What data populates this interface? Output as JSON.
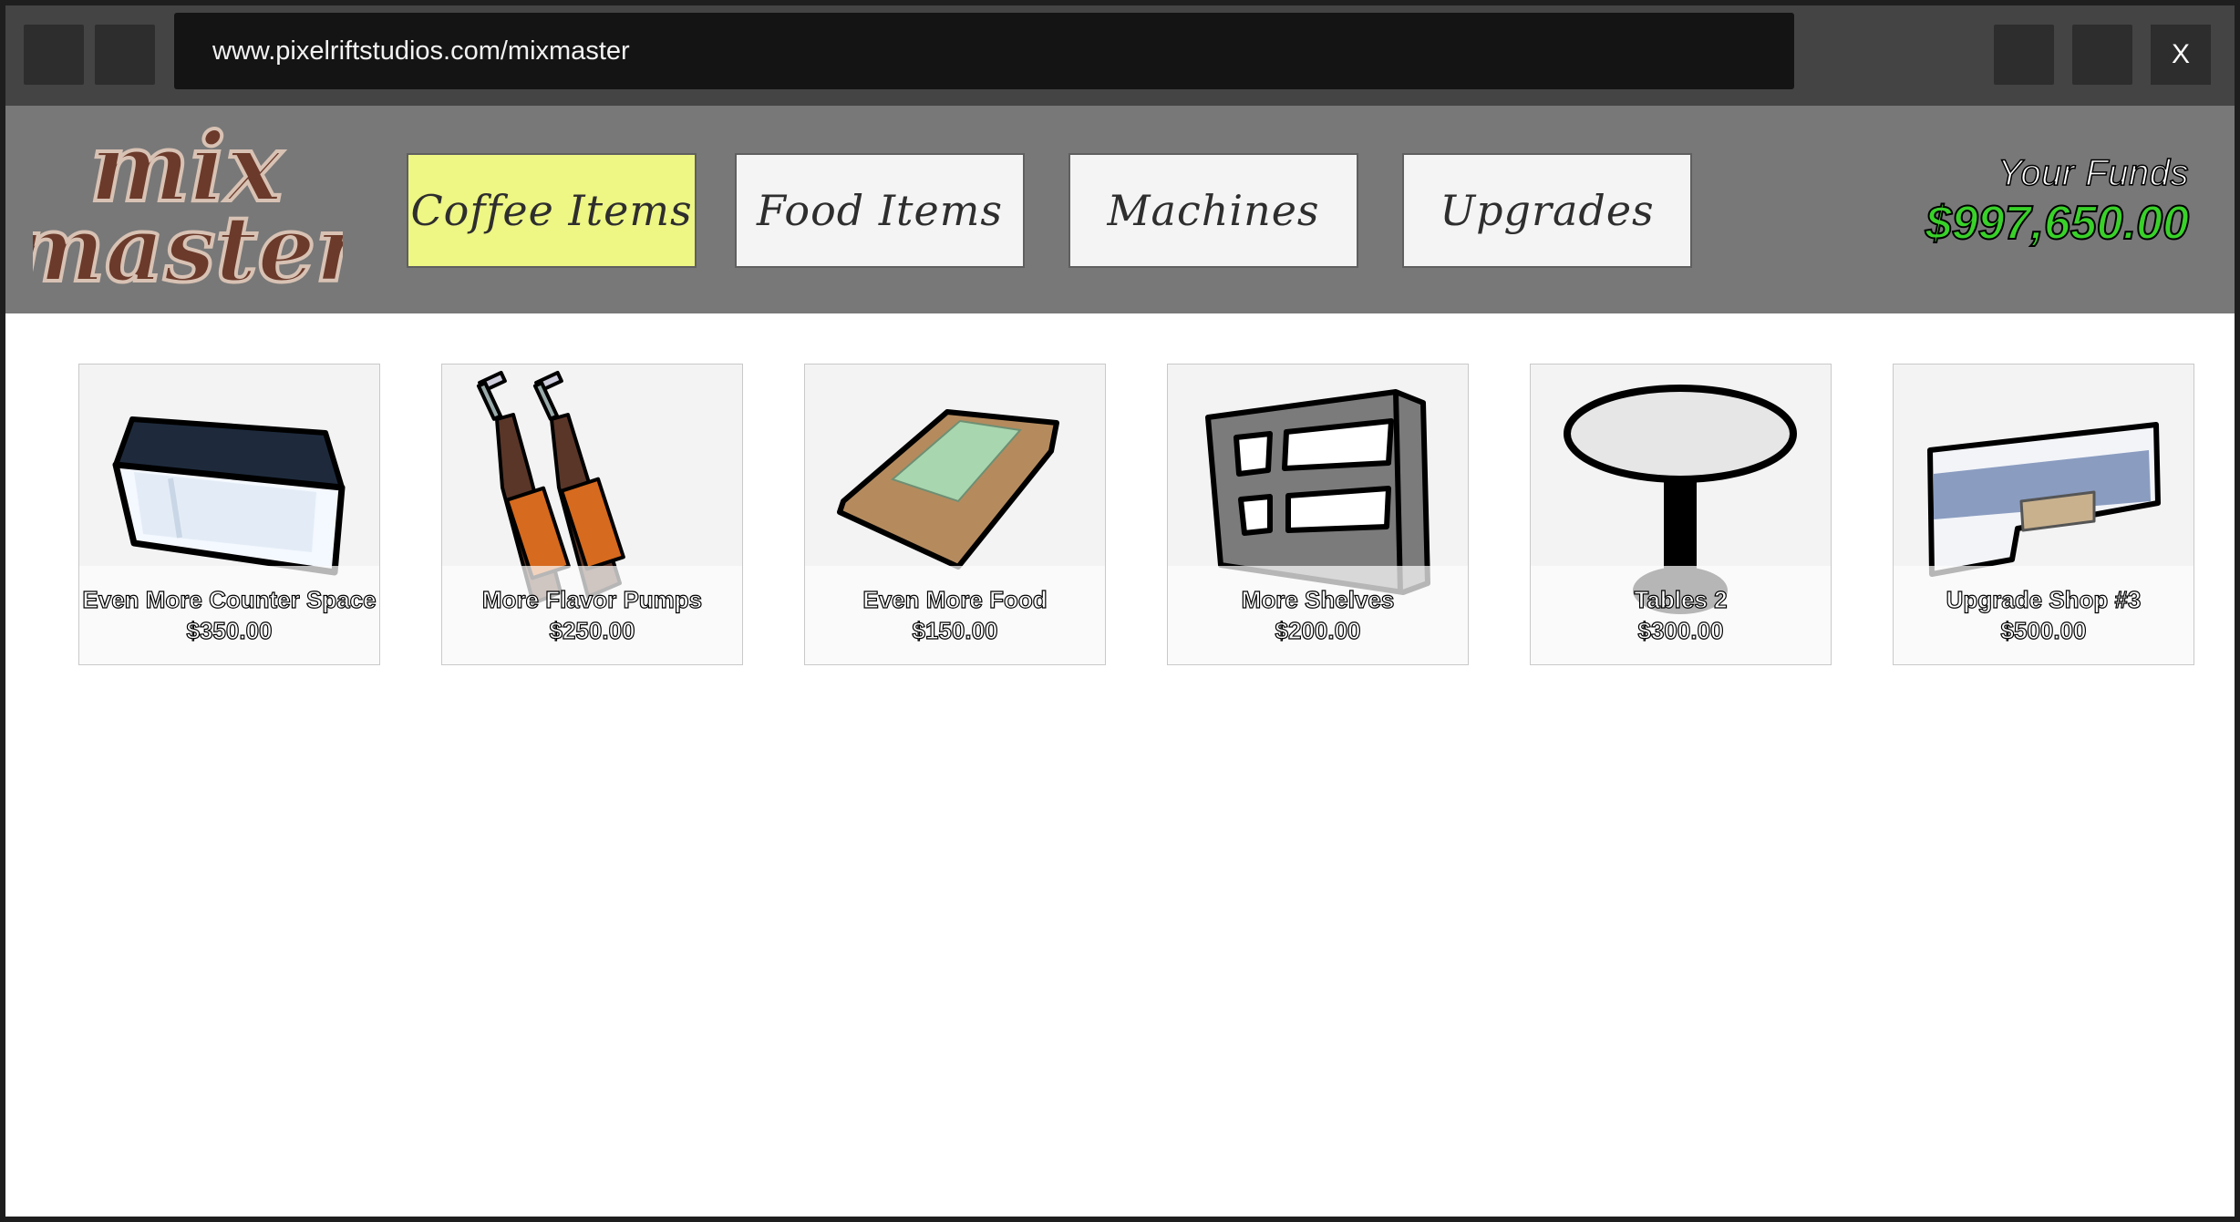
{
  "browser": {
    "url": "www.pixelriftstudios.com/mixmaster",
    "close_label": "X"
  },
  "logo": {
    "line1": "mix",
    "line2": "master",
    "icon": "mixmaster-logo"
  },
  "tabs": [
    {
      "label": "Coffee Items",
      "active": true
    },
    {
      "label": "Food Items",
      "active": false
    },
    {
      "label": "Machines",
      "active": false
    },
    {
      "label": "Upgrades",
      "active": false
    }
  ],
  "funds": {
    "label": "Your Funds",
    "value": "$997,650.00"
  },
  "items": [
    {
      "name": "Even More Counter Space",
      "price": "$350.00",
      "icon": "counter-icon"
    },
    {
      "name": "More Flavor Pumps",
      "price": "$250.00",
      "icon": "flavor-pump-bottles-icon"
    },
    {
      "name": "Even More Food",
      "price": "$150.00",
      "icon": "food-tray-icon"
    },
    {
      "name": "More Shelves",
      "price": "$200.00",
      "icon": "shelf-icon"
    },
    {
      "name": "Tables 2",
      "price": "$300.00",
      "icon": "table-icon"
    },
    {
      "name": "Upgrade Shop #3",
      "price": "$500.00",
      "icon": "shop-upgrade-icon"
    }
  ],
  "colors": {
    "active_tab": "#eef684",
    "funds": "#39d12a",
    "header": "#787878",
    "logo_brown": "#6b3a2a"
  }
}
